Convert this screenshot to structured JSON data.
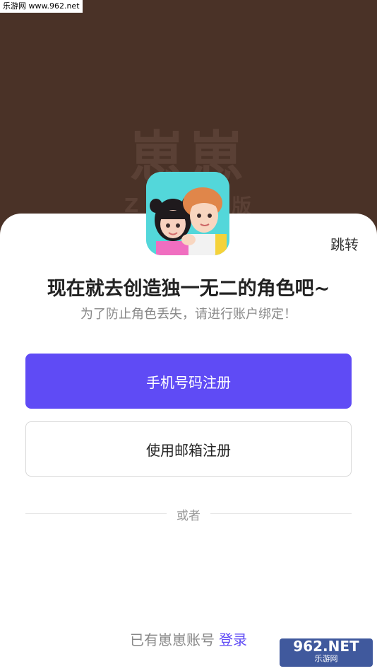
{
  "watermark_top": "乐游网 www.962.net",
  "background": {
    "title": "崽崽",
    "sub_left": "Z",
    "sub_right": "版"
  },
  "skip_label": "跳转",
  "headline": "现在就去创造独一无二的角色吧~",
  "subline": "为了防止角色丢失，请进行账户绑定！",
  "buttons": {
    "phone_register": "手机号码注册",
    "email_register": "使用邮箱注册"
  },
  "divider_text": "或者",
  "footer": {
    "prefix": "已有崽崽账号",
    "login_link": "登录"
  },
  "watermark_br": {
    "main": "962.NET",
    "sub": "乐游网"
  },
  "colors": {
    "accent": "#5f4bf5",
    "background": "#4a3227"
  }
}
